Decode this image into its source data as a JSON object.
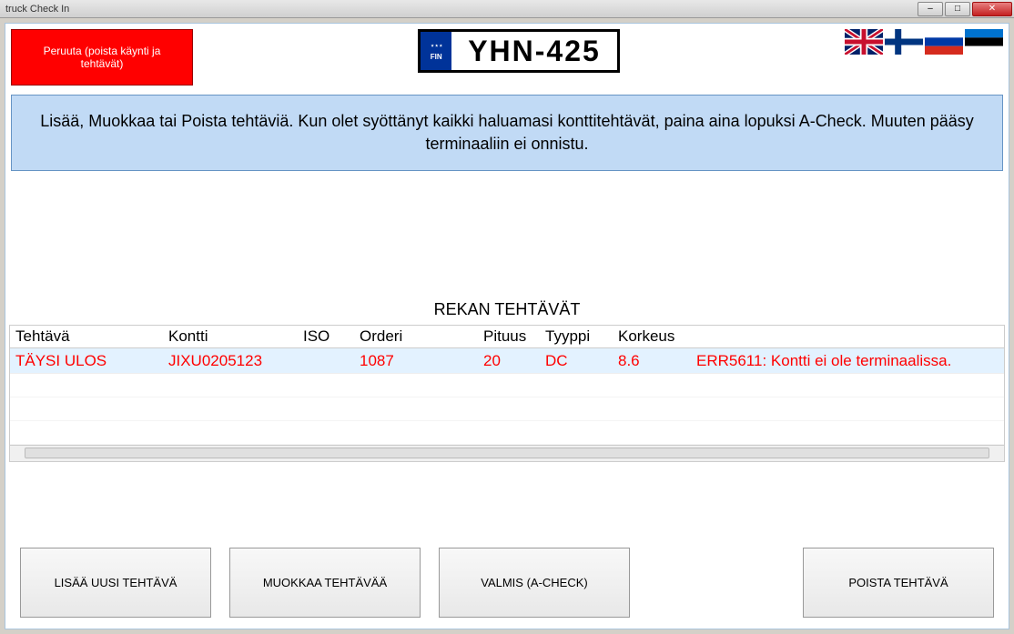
{
  "window_title": "truck Check In",
  "cancel_button": "Peruuta (poista käynti ja tehtävät)",
  "license_plate": {
    "country": "FIN",
    "number": "YHN-425"
  },
  "instruction": "Lisää, Muokkaa tai Poista tehtäviä. Kun olet syöttänyt kaikki haluamasi konttitehtävät, paina aina lopuksi A-Check. Muuten pääsy terminaaliin ei onnistu.",
  "table_title": "REKAN TEHTÄVÄT",
  "columns": {
    "tehtava": "Tehtävä",
    "kontti": "Kontti",
    "iso": "ISO",
    "orderi": "Orderi",
    "pituus": "Pituus",
    "tyyppi": "Tyyppi",
    "korkeus": "Korkeus"
  },
  "rows": [
    {
      "tehtava": "TÄYSI ULOS",
      "kontti": "JIXU0205123",
      "iso": "",
      "orderi": "1087",
      "pituus": "20",
      "tyyppi": "DC",
      "korkeus": "8.6",
      "error": "ERR5611: Kontti ei ole terminaalissa."
    }
  ],
  "buttons": {
    "add": "LISÄÄ UUSI TEHTÄVÄ",
    "edit": "MUOKKAA TEHTÄVÄÄ",
    "ready": "VALMIS (A-CHECK)",
    "delete": "POISTA TEHTÄVÄ"
  }
}
